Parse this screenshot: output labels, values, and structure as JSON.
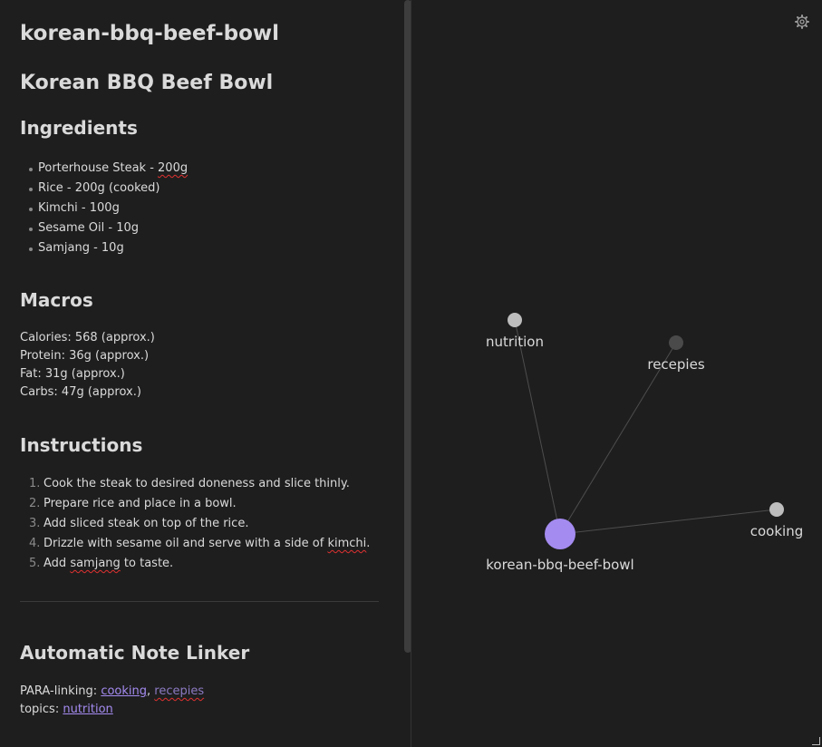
{
  "note": {
    "inline_title": "korean-bbq-beef-bowl",
    "heading": "Korean BBQ Beef Bowl",
    "ingredients": {
      "heading": "Ingredients",
      "items": [
        {
          "text": "Porterhouse Steak - ",
          "flagged": "200g"
        },
        {
          "text": "Rice - 200g (cooked)",
          "flagged": ""
        },
        {
          "text": "Kimchi - 100g",
          "flagged": ""
        },
        {
          "text": "Sesame Oil - 10g",
          "flagged": ""
        },
        {
          "text": "Samjang - 10g",
          "flagged": ""
        }
      ]
    },
    "macros": {
      "heading": "Macros",
      "lines": [
        "Calories: 568 (approx.)",
        "Protein: 36g (approx.)",
        "Fat: 31g (approx.)",
        "Carbs: 47g (approx.)"
      ]
    },
    "instructions": {
      "heading": "Instructions",
      "steps": [
        {
          "num": "1.",
          "before": "Cook the steak to desired doneness and slice thinly.",
          "flagged": "",
          "after": ""
        },
        {
          "num": "2.",
          "before": "Prepare rice and place in a bowl.",
          "flagged": "",
          "after": ""
        },
        {
          "num": "3.",
          "before": "Add sliced steak on top of the rice.",
          "flagged": "",
          "after": ""
        },
        {
          "num": "4.",
          "before": "Drizzle with sesame oil and serve with a side of ",
          "flagged": "kimchi",
          "after": "."
        },
        {
          "num": "5.",
          "before": "Add ",
          "flagged": "samjang",
          "after": " to taste."
        }
      ]
    },
    "linker": {
      "heading": "Automatic Note Linker",
      "para_label": "PARA-linking: ",
      "para_links": [
        "cooking",
        "recepies"
      ],
      "para_separator": ", ",
      "topics_label": "topics: ",
      "topics_links": [
        "nutrition"
      ]
    }
  },
  "graph": {
    "settings_icon": "gear-icon",
    "accent_color": "#a48bf0",
    "node_color": "#bdbdbd",
    "unresolved_node_color": "#4a4a4a",
    "edge_color": "#4d4d4d",
    "nodes": [
      {
        "id": "korean-bbq-beef-bowl",
        "label": "korean-bbq-beef-bowl",
        "active": true,
        "resolved": true
      },
      {
        "id": "nutrition",
        "label": "nutrition",
        "active": false,
        "resolved": true
      },
      {
        "id": "recepies",
        "label": "recepies",
        "active": false,
        "resolved": false
      },
      {
        "id": "cooking",
        "label": "cooking",
        "active": false,
        "resolved": true
      }
    ],
    "edges": [
      [
        "korean-bbq-beef-bowl",
        "nutrition"
      ],
      [
        "korean-bbq-beef-bowl",
        "recepies"
      ],
      [
        "korean-bbq-beef-bowl",
        "cooking"
      ]
    ]
  }
}
